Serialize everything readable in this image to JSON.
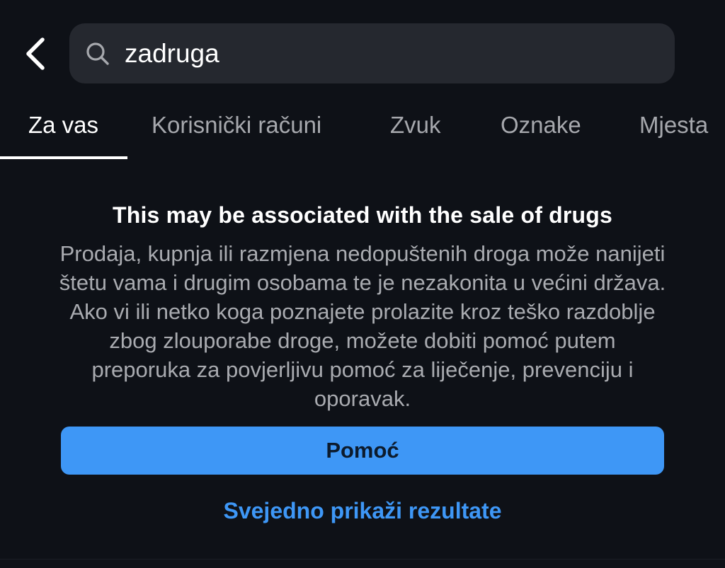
{
  "header": {
    "back_icon": "chevron-left-icon",
    "search": {
      "icon": "search-icon",
      "value": "zadruga"
    }
  },
  "tabs": [
    {
      "label": "Za vas",
      "active": true
    },
    {
      "label": "Korisnički računi",
      "active": false
    },
    {
      "label": "Zvuk",
      "active": false
    },
    {
      "label": "Oznake",
      "active": false
    },
    {
      "label": "Mjesta",
      "active": false
    }
  ],
  "warning": {
    "title": "This may be associated with the sale of drugs",
    "body": "Prodaja, kupnja ili razmjena nedopuštenih droga može nanijeti štetu vama i drugim osobama te je nezakonita u većini država. Ako vi ili netko koga poznajete prolazite kroz teško razdoblje zbog zlouporabe droge, možete dobiti pomoć putem preporuka za povjerljivu pomoć za liječenje, prevenciju i oporavak."
  },
  "actions": {
    "help_label": "Pomoć",
    "show_results_label": "Svejedno prikaži rezultate"
  },
  "colors": {
    "background": "#0e1117",
    "search_bg": "#25282f",
    "accent": "#3e97f6",
    "muted_text": "#a9abb0"
  }
}
